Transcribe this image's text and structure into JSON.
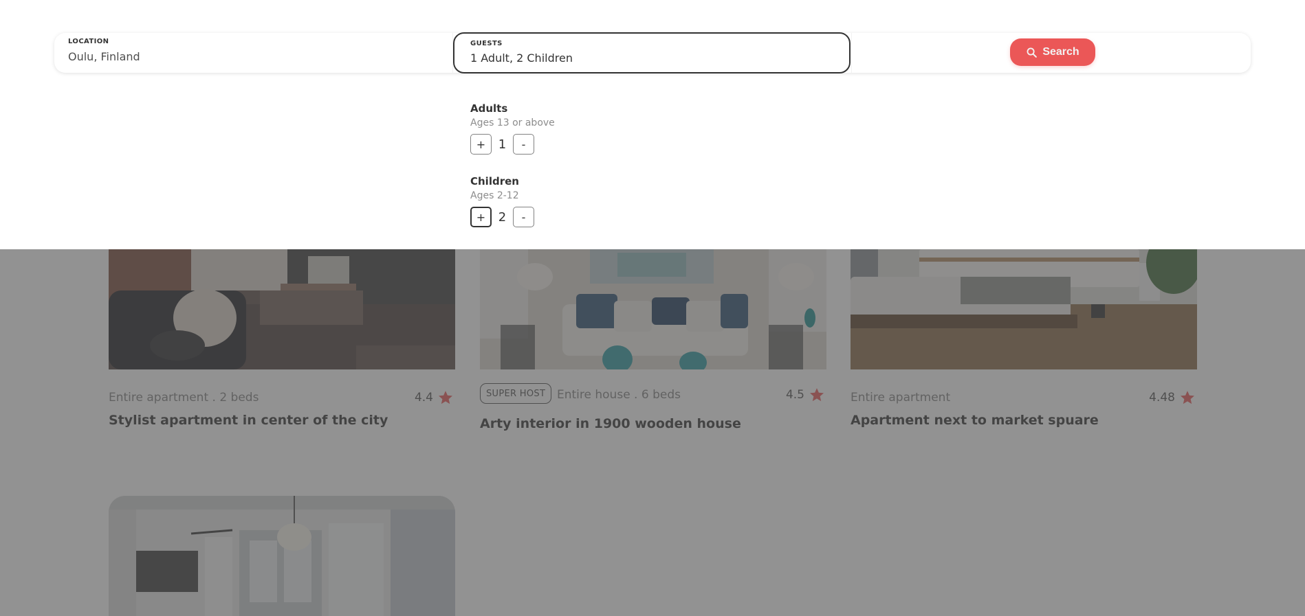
{
  "search": {
    "location_label": "LOCATION",
    "location_value": "Oulu, Finland",
    "guests_label": "GUESTS",
    "guests_value": "1 Adult, 2 Children",
    "button_label": "Search"
  },
  "guests": {
    "adults": {
      "title": "Adults",
      "subtitle": "Ages 13 or above",
      "count": "1",
      "plus": "+",
      "minus": "-"
    },
    "children": {
      "title": "Children",
      "subtitle": "Ages 2-12",
      "count": "2",
      "plus": "+",
      "minus": "-"
    }
  },
  "listings": [
    {
      "superhost": "",
      "type": "Entire apartment . 2 beds",
      "rating": "4.4",
      "title": "Stylist apartment in center of the city"
    },
    {
      "superhost": "SUPER HOST",
      "type": "Entire house . 6 beds",
      "rating": "4.5",
      "title": "Arty interior in 1900 wooden house"
    },
    {
      "superhost": "",
      "type": "Entire apartment",
      "rating": "4.48",
      "title": "Apartment next to market spuare"
    },
    {
      "superhost": "",
      "type": "",
      "rating": "",
      "title": ""
    }
  ],
  "colors": {
    "accent": "#eb5757",
    "overlay": "#4f4f4f",
    "text": "#333333",
    "muted": "#828282"
  },
  "icons": {
    "search_button": "search-icon",
    "rating": "star-icon"
  }
}
